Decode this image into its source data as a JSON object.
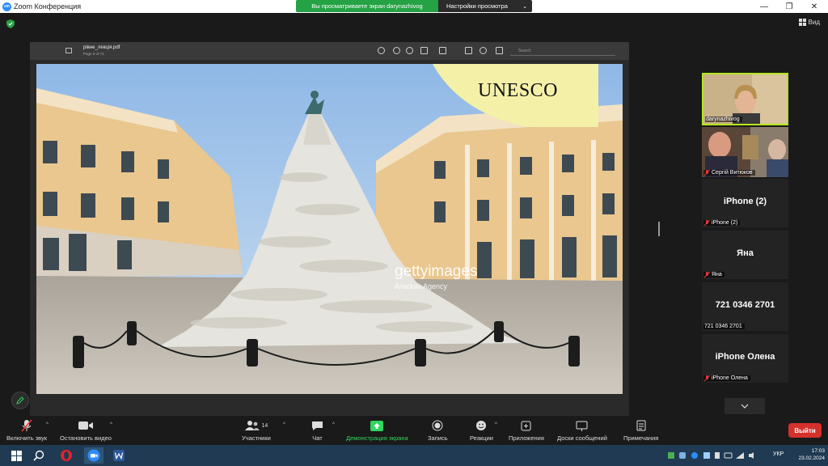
{
  "window": {
    "title": "Zoom Конференция",
    "logo_text": "zm",
    "share_banner": "Вы просматриваете экран darynazhivog",
    "view_settings": "Настройки просмотра",
    "minimize": "—",
    "maximize": "❐",
    "close": "✕"
  },
  "main": {
    "view_label": "Вид"
  },
  "pdf": {
    "filename": "рівне_лекція.pdf",
    "page_info": "Page 5 of 73",
    "search_placeholder": "Search"
  },
  "slide": {
    "heading": "UNESCO",
    "watermark": "gettyimages",
    "watermark_sub": "Anadolu Agency"
  },
  "participants": [
    {
      "name": "darynazhivog",
      "type": "video",
      "active": true
    },
    {
      "name": "Сергій Витюков",
      "type": "video",
      "muted": true
    },
    {
      "big": "iPhone (2)",
      "name": "iPhone (2)",
      "muted": true
    },
    {
      "big": "Яна",
      "name": "Яна",
      "muted": true
    },
    {
      "big": "721 0346 2701",
      "name": "721 0346 2701",
      "muted": false
    },
    {
      "big": "iPhone Олена",
      "name": "iPhone Олена",
      "muted": true
    }
  ],
  "toolbar": {
    "mic": "Включить звук",
    "video": "Остановить видео",
    "participants": "Участники",
    "participants_count": "14",
    "chat": "Чат",
    "share": "Демонстрация экрана",
    "record": "Запись",
    "reactions": "Реакции",
    "apps": "Приложения",
    "whiteboards": "Доски сообщений",
    "notes": "Примечания",
    "leave": "Выйти"
  },
  "taskbar": {
    "lang": "УКР",
    "time": "17:03",
    "date": "23.02.2024"
  },
  "colors": {
    "accent_green": "#25a244",
    "active_border": "#b5e61d",
    "leave_red": "#d5312c",
    "taskbar": "#1f3a52"
  }
}
